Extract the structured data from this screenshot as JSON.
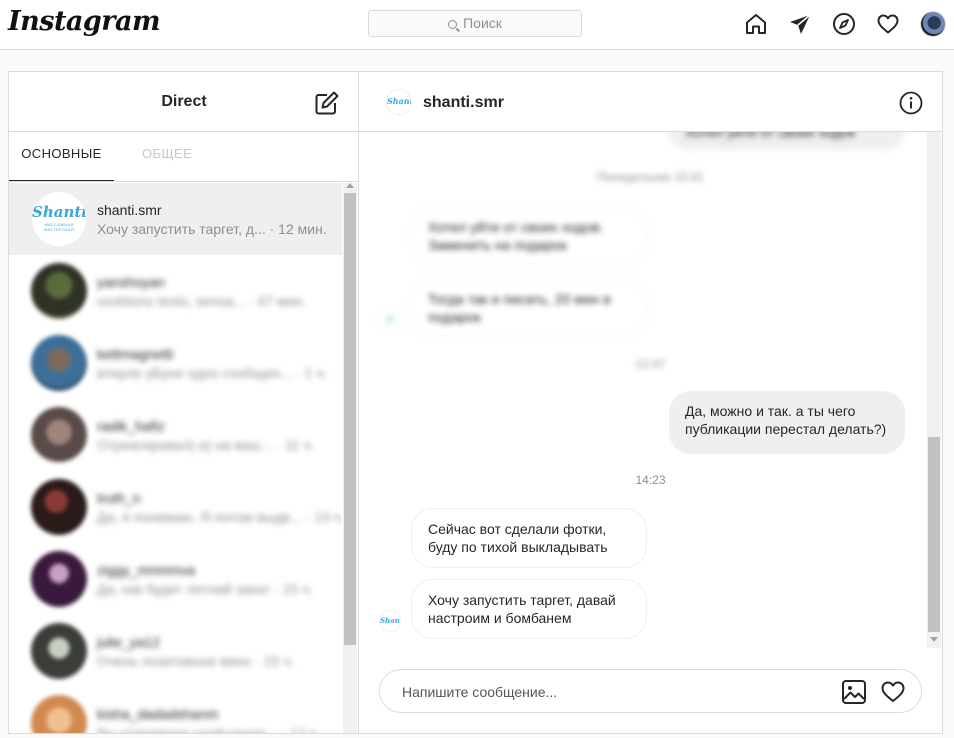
{
  "topbar": {
    "logo": "Instagram",
    "search_placeholder": "Поиск",
    "icons": [
      "home-icon",
      "direct-icon",
      "explore-icon",
      "heart-icon",
      "avatar"
    ]
  },
  "inbox": {
    "title": "Direct",
    "tabs": [
      {
        "label": "ОСНОВНЫЕ",
        "active": true
      },
      {
        "label": "ОБЩЕЕ",
        "active": false
      }
    ],
    "threads": [
      {
        "name": "shanti.smr",
        "preview": "Хочу запустить таргет, д... · 12 мин.",
        "active": true,
        "avatar": {
          "word": "Shanti",
          "sub": "МАССАЖНАЯ МАСТЕРСКАЯ"
        }
      },
      {
        "name": "yanshoyan",
        "preview": "usvbtonu testo, sensa... · 47 мин.",
        "active": false
      },
      {
        "name": "kettmagnetti",
        "preview": "втерле уБуне одно сообщен... · 1 ч.",
        "active": false
      },
      {
        "name": "radik_hafiz",
        "preview": "Отреагировал(-а) на ваш... · 11 ч.",
        "active": false
      },
      {
        "name": "truth_n",
        "preview": "Да, я понимаю. Я потом выдв... · 13 ч.",
        "active": false
      },
      {
        "name": "ziggy_mnmmva",
        "preview": "Да, как будет летний закат · 15 ч.",
        "active": false
      },
      {
        "name": "julie_ya12",
        "preview": "Очень позитивное вино · 15 ч.",
        "active": false
      },
      {
        "name": "kisha_dadadshanm",
        "preview": "Вы отправили сообщение... · 17 ч.",
        "active": false
      }
    ]
  },
  "chat": {
    "contact": "shanti.smr",
    "contact_avatar_word": "Shanti",
    "messages_blurred": [
      {
        "text": "Хотел уйти от своих ходок",
        "dir": "out"
      },
      {
        "text": "Понедельник 10:41",
        "kind": "stamp"
      },
      {
        "text": "Хотел уйти от своих ходов. Заменить на подарок",
        "dir": "in"
      },
      {
        "text": "Тогда так и писать, 20 мин в подарок",
        "dir": "in"
      },
      {
        "text": "12:47",
        "kind": "stamp"
      }
    ],
    "messages": [
      {
        "text": "Да, можно и так. а ты чего публикации перестал делать?)",
        "dir": "out"
      },
      {
        "text": "14:23",
        "kind": "stamp"
      },
      {
        "text": "Сейчас вот сделали фотки, буду по тихой выкладывать",
        "dir": "in"
      },
      {
        "text": "Хочу запустить таргет, давай настроим и бомбанем",
        "dir": "in"
      }
    ],
    "composer_placeholder": "Напишите сообщение..."
  }
}
